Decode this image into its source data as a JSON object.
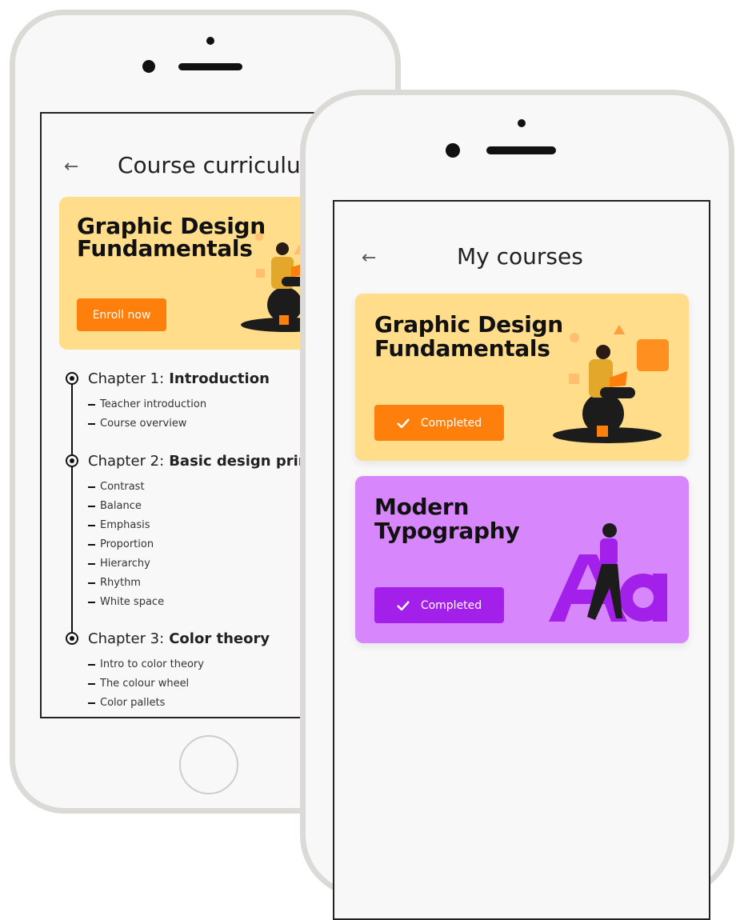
{
  "curriculum_screen": {
    "title": "Course curriculum",
    "course_title_line1": "Graphic Design",
    "course_title_line2": "Fundamentals",
    "enroll_label": "Enroll now",
    "chapters": [
      {
        "prefix": "Chapter 1:",
        "name": "Introduction",
        "lessons": [
          "Teacher introduction",
          "Course overview"
        ]
      },
      {
        "prefix": "Chapter 2:",
        "name": "Basic design principles",
        "lessons": [
          "Contrast",
          "Balance",
          "Emphasis",
          "Proportion",
          "Hierarchy",
          "Rhythm",
          "White space"
        ]
      },
      {
        "prefix": "Chapter 3:",
        "name": "Color theory",
        "lessons": [
          "Intro to color theory",
          "The colour wheel",
          "Color pallets"
        ]
      }
    ]
  },
  "courses_screen": {
    "title": "My courses",
    "courses": [
      {
        "title_line1": "Graphic Design",
        "title_line2": "Fundamentals",
        "status": "Completed"
      },
      {
        "title_line1": "Modern",
        "title_line2": "Typography",
        "status": "Completed"
      }
    ]
  },
  "colors": {
    "yellow_card": "#ffdd8a",
    "orange_button": "#ff7f0d",
    "purple_card": "#d886fc",
    "purple_button": "#a31fea"
  },
  "icons": [
    "back-arrow-icon",
    "check-icon",
    "reader-illustration",
    "walking-woman-illustration"
  ]
}
